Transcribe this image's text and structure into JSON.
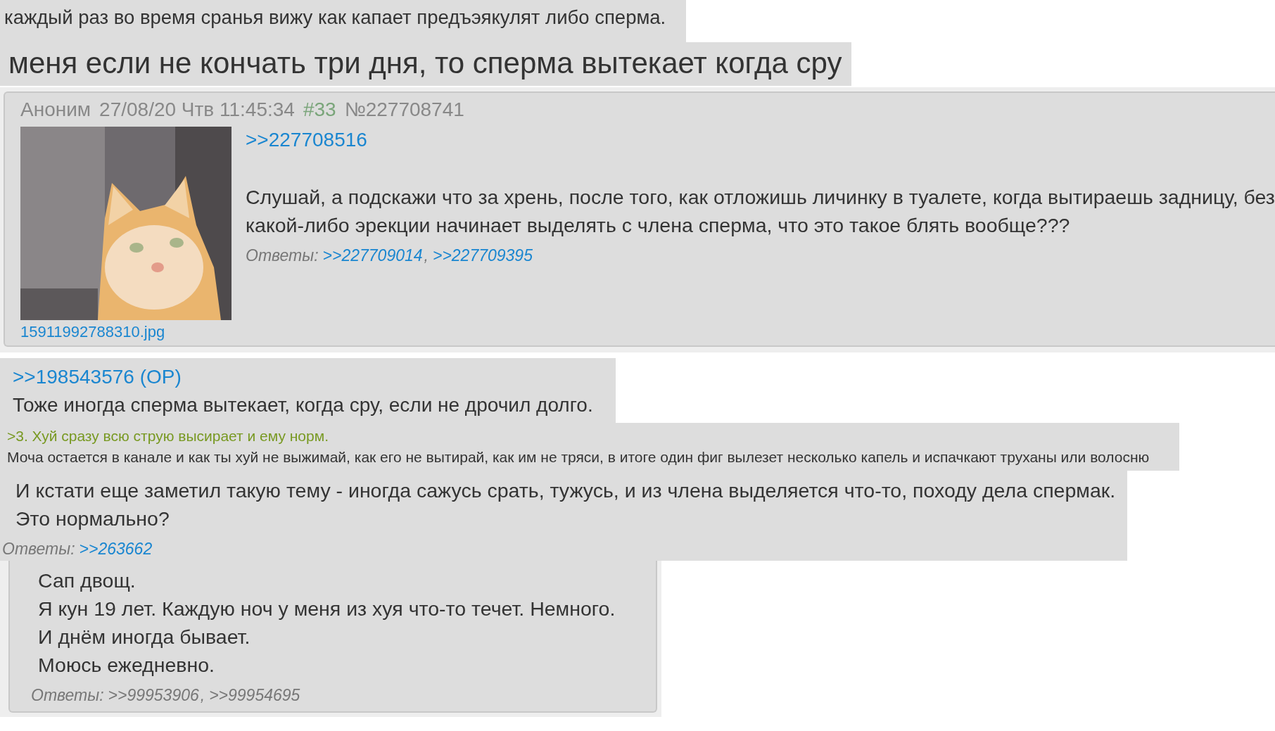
{
  "fragments": [
    {
      "kind": "text",
      "lines": [
        "каждый раз во время сранья вижу как капает предъэякулят либо сперма."
      ]
    },
    {
      "kind": "text_large",
      "lines": [
        "меня если не кончать три дня, то сперма вытекает когда сру"
      ]
    },
    {
      "kind": "post",
      "author": "Аноним",
      "date": "27/08/20 Чтв 11:45:34",
      "index": "#33",
      "number": "№227708741",
      "image": {
        "kind": "picture",
        "filename": "15911992788310.jpg"
      },
      "quote_link": ">>227708516",
      "lines": [
        "Слушай, а подскажи что за хрень, после того, как отложишь личинку в туалете, когда вытираешь задницу, без",
        "какой-либо эрекции начинает выделять с члена сперма, что это такое блять вообще???"
      ],
      "replies_label": "Ответы:",
      "separator": ",",
      "replies": [
        ">>227709014",
        ">>227709395"
      ]
    },
    {
      "kind": "quoted_text",
      "quote_link": ">>198543576 (OP)",
      "lines": [
        "Тоже иногда сперма вытекает, когда сру, если не дрочил долго."
      ]
    },
    {
      "kind": "greentext",
      "quote": ">3. Хуй сразу всю струю высирает и ему норм.",
      "lines": [
        "Моча остается в канале и как ты хуй не выжимай, как его не вытирай, как им не тряси, в итоге один фиг вылезет несколько капель и испачкают труханы или волосню"
      ]
    },
    {
      "kind": "text_replies",
      "lines": [
        "И кстати еще заметил такую тему - иногда сажусь срать, тужусь, и из члена выделяется что-то, походу дела спермак.",
        "Это нормально?"
      ],
      "replies_label": "Ответы:",
      "replies": [
        ">>263662"
      ]
    },
    {
      "kind": "card",
      "lines": [
        "Сап двощ.",
        "Я кун 19 лет. Каждую ноч у меня из хуя что-то течет. Немного.",
        "И днём иногда бывает.",
        "Моюсь ежедневно."
      ],
      "replies_label": "Ответы:",
      "separator": ",",
      "replies": [
        ">>99953906",
        ">>99954695"
      ]
    }
  ]
}
